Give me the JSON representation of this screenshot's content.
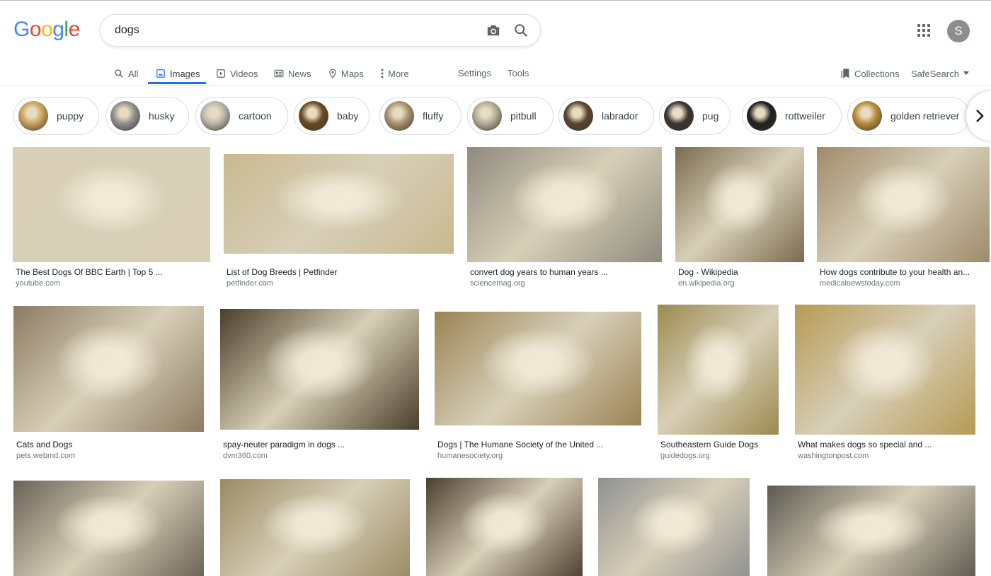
{
  "header": {
    "logo": [
      "G",
      "o",
      "o",
      "g",
      "l",
      "e"
    ],
    "search_value": "dogs",
    "avatar_letter": "S"
  },
  "tabs": [
    {
      "label": "All",
      "icon": "search-icon"
    },
    {
      "label": "Images",
      "icon": "image-icon",
      "active": true
    },
    {
      "label": "Videos",
      "icon": "video-icon"
    },
    {
      "label": "News",
      "icon": "news-icon"
    },
    {
      "label": "Maps",
      "icon": "map-pin-icon"
    },
    {
      "label": "More",
      "icon": "more-vert-icon"
    }
  ],
  "tools": {
    "settings": "Settings",
    "tools": "Tools",
    "collections": "Collections",
    "safesearch": "SafeSearch"
  },
  "chips": [
    {
      "label": "puppy",
      "color": "#c9a25a"
    },
    {
      "label": "husky",
      "color": "#8f8f8f"
    },
    {
      "label": "cartoon",
      "color": "#b8b6a8"
    },
    {
      "label": "baby",
      "color": "#6b4a22"
    },
    {
      "label": "fluffy",
      "color": "#a89070"
    },
    {
      "label": "pitbull",
      "color": "#b3aa98"
    },
    {
      "label": "labrador",
      "color": "#5a4530"
    },
    {
      "label": "pug",
      "color": "#3a3530"
    },
    {
      "label": "rottweiler",
      "color": "#202020"
    },
    {
      "label": "golden retriever",
      "color": "#b88a3a"
    }
  ],
  "results": [
    {
      "title": "The Best Dogs Of BBC Earth | Top 5 ...",
      "source": "youtube.com",
      "color": "#d8cfb5"
    },
    {
      "title": "List of Dog Breeds | Petfinder",
      "source": "petfinder.com",
      "color": "#c8b98f"
    },
    {
      "title": "convert dog years to human years ...",
      "source": "sciencemag.org",
      "color": "#8e8a7e"
    },
    {
      "title": "Dog - Wikipedia",
      "source": "en.wikipedia.org",
      "color": "#7a6b4e"
    },
    {
      "title": "How dogs contribute to your health an...",
      "source": "medicalnewstoday.com",
      "color": "#9e8a6a"
    },
    {
      "title": "Cats and Dogs",
      "source": "pets.webmd.com",
      "color": "#8c7b62"
    },
    {
      "title": "spay-neuter paradigm in dogs ...",
      "source": "dvm360.com",
      "color": "#4a3f2a"
    },
    {
      "title": "Dogs | The Humane Society of the United ...",
      "source": "humanesociety.org",
      "color": "#9a8455"
    },
    {
      "title": "Southeastern Guide Dogs",
      "source": "guidedogs.org",
      "color": "#9a8a4e"
    },
    {
      "title": "What makes dogs so special and ...",
      "source": "washingtonpost.com",
      "color": "#b69a55"
    },
    {
      "title": "",
      "source": "",
      "color": "#6a6255"
    },
    {
      "title": "",
      "source": "",
      "color": "#9a8a62"
    },
    {
      "title": "",
      "source": "",
      "color": "#4b3f30"
    },
    {
      "title": "",
      "source": "",
      "color": "#8f9090"
    },
    {
      "title": "",
      "source": "",
      "color": "#5e5a52"
    }
  ]
}
